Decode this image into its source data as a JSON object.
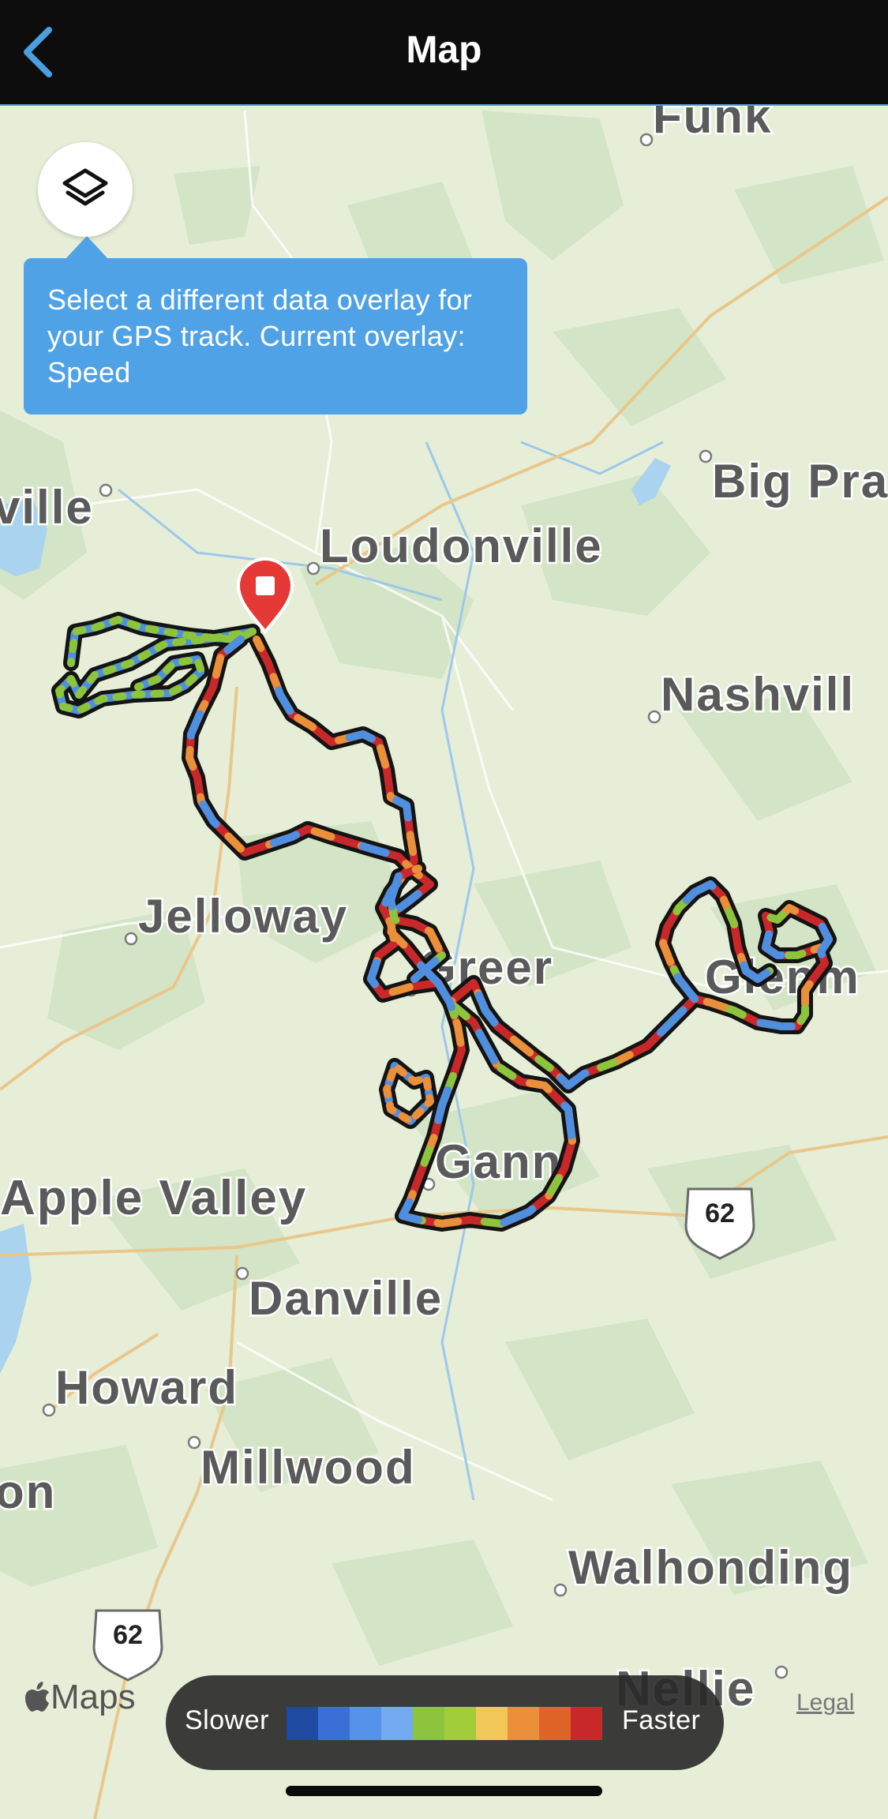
{
  "nav": {
    "title": "Map",
    "back_icon": "chevron-left-icon",
    "accent_color": "#4a9fe0"
  },
  "layers_button": {
    "icon": "layers-icon"
  },
  "tooltip": {
    "text": "Select a different data overlay for your GPS track. Current overlay: Speed",
    "color": "#4fa2e6"
  },
  "map": {
    "places": [
      "Funk",
      "Big Pra",
      "ville",
      "Loudonville",
      "Nashvill",
      "Jelloway",
      "Greer",
      "Glenm",
      "Gann",
      "Apple Valley",
      "Danville",
      "Howard",
      "Millwood",
      "on",
      "Walhonding",
      "Nellie"
    ],
    "route_shields": [
      "62",
      "62"
    ],
    "markers": {
      "start_color": "#3fa83c",
      "end_color": "#e53935",
      "end_icon": "stop-square-icon"
    }
  },
  "branding": {
    "maps_label": "Maps",
    "logo_icon": "apple-logo-icon",
    "legal": "Legal"
  },
  "legend": {
    "slower": "Slower",
    "faster": "Faster",
    "colors": [
      "#1e4aa2",
      "#3a6fd6",
      "#5691ea",
      "#74aaf2",
      "#8dc43e",
      "#a3cc3a",
      "#f2c75a",
      "#ea8f3a",
      "#df6428",
      "#c9282a"
    ]
  }
}
